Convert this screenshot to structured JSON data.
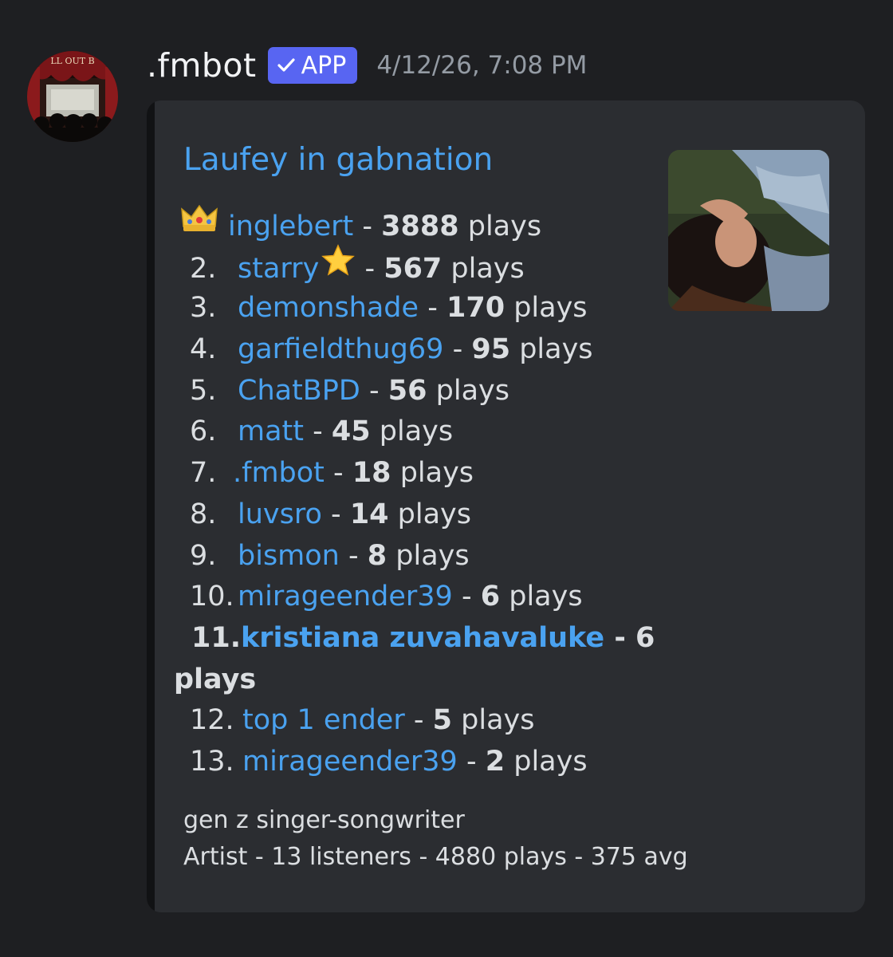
{
  "message": {
    "author": ".fmbot",
    "badge": "APP",
    "timestamp": "4/12/26, 7:08 PM"
  },
  "embed": {
    "title": "Laufey in gabnation",
    "separator": "-",
    "unit": "plays",
    "rows": [
      {
        "rank": "",
        "name": "inglebert",
        "count": "3888"
      },
      {
        "rank": "2.",
        "name": "starry",
        "count": "567"
      },
      {
        "rank": "3.",
        "name": "demonshade",
        "count": "170"
      },
      {
        "rank": "4.",
        "name": "garfieldthug69",
        "count": "95"
      },
      {
        "rank": "5.",
        "name": "ChatBPD",
        "count": "56"
      },
      {
        "rank": "6.",
        "name": "matt",
        "count": "45"
      },
      {
        "rank": "7.",
        "name": ".fmbot",
        "count": "18"
      },
      {
        "rank": "8.",
        "name": "luvsro",
        "count": "14"
      },
      {
        "rank": "9.",
        "name": "bismon",
        "count": "8"
      },
      {
        "rank": "10.",
        "name": "mirageender39",
        "count": "6"
      },
      {
        "rank": "11.",
        "name": "kristiana zuvahavaluke",
        "count": "6"
      },
      {
        "rank": "12.",
        "name": "top 1 ender",
        "count": "5"
      },
      {
        "rank": "13.",
        "name": "mirageender39",
        "count": "2"
      }
    ],
    "footer_line1": "gen z singer-songwriter",
    "footer_line2": "Artist - 13 listeners - 4880 plays - 375 avg"
  },
  "avatar_text": "LL OUT B",
  "colors": {
    "background": "#1e1f22",
    "embed_bg": "#2b2d31",
    "link": "#4aa2f0",
    "badge": "#5865f2",
    "timestamp": "#949ba4"
  }
}
